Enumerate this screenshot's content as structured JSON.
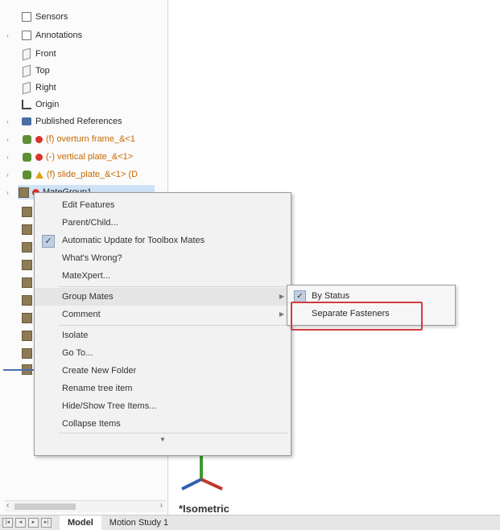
{
  "tree": {
    "items": [
      {
        "label": "Sensors",
        "icon": "sensor-icon",
        "expander": false
      },
      {
        "label": "Annotations",
        "icon": "annotations-icon",
        "expander": true
      },
      {
        "label": "Front",
        "icon": "plane-icon",
        "expander": false
      },
      {
        "label": "Top",
        "icon": "plane-icon",
        "expander": false
      },
      {
        "label": "Right",
        "icon": "plane-icon",
        "expander": false
      },
      {
        "label": "Origin",
        "icon": "origin-icon",
        "expander": false
      },
      {
        "label": "Published References",
        "icon": "published-references-icon",
        "expander": true
      },
      {
        "label": "(f) overturn frame_&<1",
        "icon": "part-icon",
        "status": "error",
        "expander": true
      },
      {
        "label": "(-) vertical plate_&<1>",
        "icon": "part-icon",
        "status": "error",
        "expander": true
      },
      {
        "label": "(f) slide_plate_&<1> (D",
        "icon": "part-icon",
        "status": "warning",
        "expander": true
      },
      {
        "label": "MateGroup1",
        "icon": "mategroup-icon",
        "status": "error",
        "expander": true
      }
    ]
  },
  "context_menu": {
    "items": [
      {
        "label": "Edit Features"
      },
      {
        "label": "Parent/Child..."
      },
      {
        "label": "Automatic Update for Toolbox Mates",
        "checked": true
      },
      {
        "label": "What's Wrong?"
      },
      {
        "label": "MateXpert..."
      },
      {
        "label": "Group Mates",
        "submenu": true
      },
      {
        "label": "Comment",
        "submenu": true
      },
      {
        "label": "Isolate"
      },
      {
        "label": "Go To..."
      },
      {
        "label": "Create New Folder"
      },
      {
        "label": "Rename tree item"
      },
      {
        "label": "Hide/Show Tree Items..."
      },
      {
        "label": "Collapse Items"
      }
    ]
  },
  "submenu": {
    "items": [
      {
        "label": "By Status",
        "checked": true
      },
      {
        "label": "Separate Fasteners"
      }
    ]
  },
  "view_label": "*Isometric",
  "tabs": [
    {
      "label": "Model",
      "active": true
    },
    {
      "label": "Motion Study 1",
      "active": false
    }
  ],
  "colors": {
    "highlight": "#d23c3c",
    "selection": "#cfe3f7",
    "warning": "#e2a21a",
    "error": "#d9342b"
  }
}
